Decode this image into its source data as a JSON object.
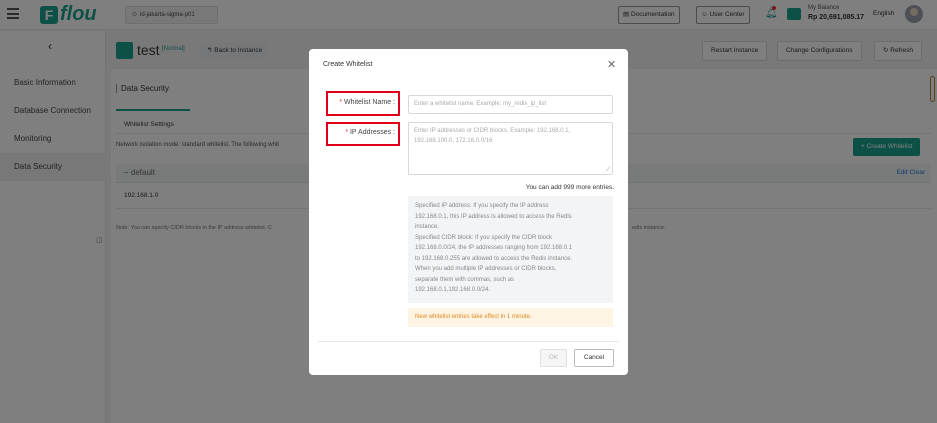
{
  "topbar": {
    "logo_text": "flou",
    "region": "id-jakarta-sigma-p01",
    "documentation": "Documentation",
    "user_center": "User Center",
    "balance_label": "My Balance",
    "balance_value": "Rp 20,691,085.17",
    "language": "English",
    "icons": [
      "menu-icon",
      "location-pin-icon",
      "document-icon",
      "user-icon",
      "bell-icon",
      "wallet-icon",
      "avatar"
    ]
  },
  "sidebar": {
    "items": [
      {
        "label": "Basic Information"
      },
      {
        "label": "Database Connection"
      },
      {
        "label": "Monitoring"
      },
      {
        "label": "Data Security"
      }
    ]
  },
  "instance": {
    "name": "test",
    "status": "[Normal]",
    "back_label": "Back to Instance",
    "restart": "Restart Instance",
    "change_config": "Change Configurations",
    "refresh": "Refresh"
  },
  "content": {
    "section_title": "Data Security",
    "subtab": "Whitelist Settings",
    "isolation": "Network isolation mode: standard whitelist. The following whit",
    "create_whitelist": "+ Create Whitelist",
    "group_name": "default",
    "group_actions": "Edit Clear",
    "ip_value": "192.168.1.0",
    "note": "Note: You can specify CIDR blocks in the IP address whitelist. C",
    "note_tail": "edis instance."
  },
  "modal": {
    "title": "Create Whitelist",
    "whitelist_name_label": "Whitelist Name :",
    "whitelist_name_placeholder": "Enter a whitelist name. Example: my_redis_ip_list",
    "ip_label": "IP Addresses :",
    "ip_placeholder": "Enter IP addresses or CIDR blocks. Example: 192.168.0.1, 192.168.100.0, 172.16.0.0/16",
    "count_note": "You can add 999 more entries.",
    "help_lines": [
      "Specified IP address: If you specify the IP address",
      "192.168.0.1, this IP address is allowed to access the Redis",
      "instance.",
      "Specified CIDR block: If you specify the CIDR block",
      "192.168.0.0/24, the IP addresses ranging from 192.168.0.1",
      "to 192.168.0.255 are allowed to access the Redis instance.",
      "When you add multiple IP addresses or CIDR blocks,",
      "separate them with commas, such as",
      "192.168.0.1,192.168.0.0/24."
    ],
    "warning": "New whitelist entries take effect in 1 minute.",
    "ok": "OK",
    "cancel": "Cancel"
  },
  "colors": {
    "brand": "#1aa28d",
    "highlight": "#e0001a",
    "warning_text": "#e08a1e"
  }
}
